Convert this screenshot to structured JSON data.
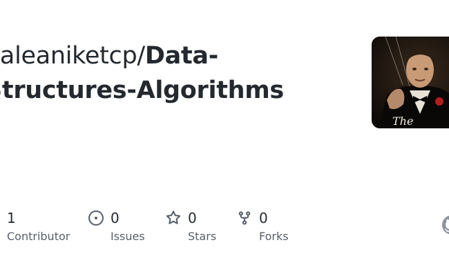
{
  "repo": {
    "owner": "paleaniketcp",
    "separator": "/",
    "name": "Data-Structures-Algorithms"
  },
  "avatar": {
    "text": "The"
  },
  "stats": {
    "contributors": {
      "count": "1",
      "label": "Contributor",
      "icon": "people-icon"
    },
    "issues": {
      "count": "0",
      "label": "Issues",
      "icon": "issue-opened-icon"
    },
    "stars": {
      "count": "0",
      "label": "Stars",
      "icon": "star-icon"
    },
    "forks": {
      "count": "0",
      "label": "Forks",
      "icon": "repo-forked-icon"
    }
  },
  "colors": {
    "text": "#24292f",
    "muted": "#57606a",
    "icon": "#57606a"
  }
}
